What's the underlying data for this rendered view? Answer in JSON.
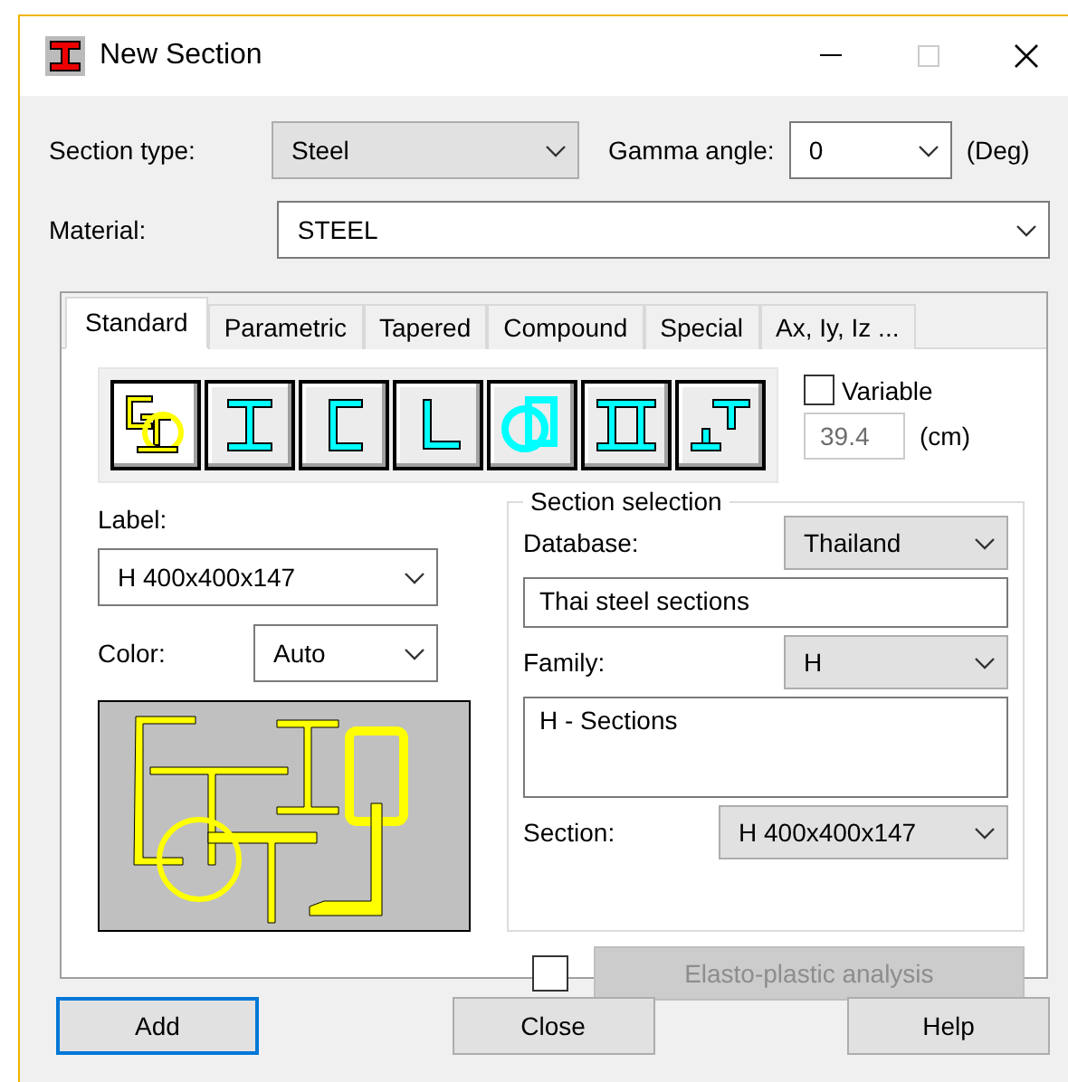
{
  "window": {
    "title": "New Section"
  },
  "section_type": {
    "label": "Section type:",
    "value": "Steel"
  },
  "gamma_angle": {
    "label": "Gamma angle:",
    "value": "0",
    "unit": "(Deg)"
  },
  "material": {
    "label": "Material:",
    "value": "STEEL"
  },
  "tabs": [
    {
      "label": "Standard",
      "selected": true
    },
    {
      "label": "Parametric",
      "selected": false
    },
    {
      "label": "Tapered",
      "selected": false
    },
    {
      "label": "Compound",
      "selected": false
    },
    {
      "label": "Special",
      "selected": false
    },
    {
      "label": "Ax, Iy, Iz ...",
      "selected": false
    }
  ],
  "shape_buttons": [
    {
      "kind": "all",
      "selected": true
    },
    {
      "kind": "i",
      "selected": false
    },
    {
      "kind": "channel",
      "selected": false
    },
    {
      "kind": "angle",
      "selected": false
    },
    {
      "kind": "tube",
      "selected": false
    },
    {
      "kind": "double",
      "selected": false
    },
    {
      "kind": "tee",
      "selected": false
    }
  ],
  "variable": {
    "label": "Variable",
    "checked": false,
    "value": "39.4",
    "value_disabled": true,
    "unit": "(cm)"
  },
  "label_field": {
    "label": "Label:",
    "value": "H 400x400x147"
  },
  "color_field": {
    "label": "Color:",
    "value": "Auto"
  },
  "section_selection": {
    "title": "Section selection",
    "database_label": "Database:",
    "database": "Thailand",
    "database_name": "Thai steel sections",
    "family_label": "Family:",
    "family": "H",
    "family_name": "H - Sections",
    "section_label": "Section:",
    "section": "H 400x400x147"
  },
  "elasto_plastic": {
    "checked": false,
    "label": "Elasto-plastic analysis",
    "disabled": true
  },
  "buttons": [
    {
      "label": "Add",
      "default": true
    },
    {
      "label": "Close",
      "default": false
    },
    {
      "label": "Help",
      "default": false
    }
  ]
}
